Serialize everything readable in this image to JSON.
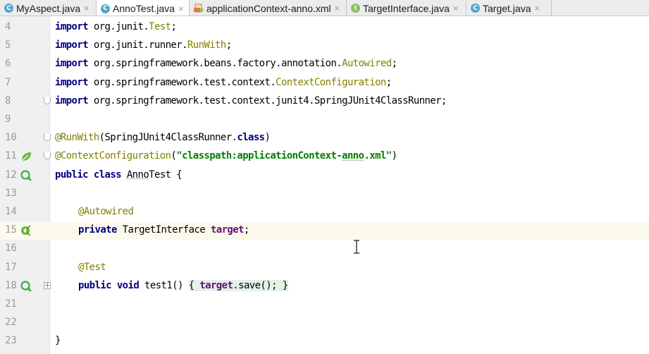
{
  "tabs": [
    {
      "label": "MyAspect.java",
      "icon": "class-icon",
      "badge": "C",
      "active": false
    },
    {
      "label": "AnnoTest.java",
      "icon": "class-icon",
      "badge": "C",
      "active": true
    },
    {
      "label": "applicationContext-anno.xml",
      "icon": "xml-file-icon",
      "badge": "",
      "active": false
    },
    {
      "label": "TargetInterface.java",
      "icon": "interface-icon",
      "badge": "I",
      "active": false
    },
    {
      "label": "Target.java",
      "icon": "class-icon",
      "badge": "C",
      "active": false
    }
  ],
  "close_glyph": "×",
  "lines": [
    {
      "num": "4",
      "indent": 0,
      "tokens": [
        {
          "t": "import",
          "c": "kw"
        },
        {
          "t": " org.junit.",
          "c": "pkg"
        },
        {
          "t": "Test",
          "c": "cls"
        },
        {
          "t": ";",
          "c": "pkg"
        }
      ]
    },
    {
      "num": "5",
      "indent": 0,
      "tokens": [
        {
          "t": "import",
          "c": "kw"
        },
        {
          "t": " org.junit.runner.",
          "c": "pkg"
        },
        {
          "t": "RunWith",
          "c": "cls"
        },
        {
          "t": ";",
          "c": "pkg"
        }
      ]
    },
    {
      "num": "6",
      "indent": 0,
      "tokens": [
        {
          "t": "import",
          "c": "kw"
        },
        {
          "t": " org.springframework.beans.factory.annotation.",
          "c": "pkg"
        },
        {
          "t": "Autowired",
          "c": "cls"
        },
        {
          "t": ";",
          "c": "pkg"
        }
      ]
    },
    {
      "num": "7",
      "indent": 0,
      "tokens": [
        {
          "t": "import",
          "c": "kw"
        },
        {
          "t": " org.springframework.test.context.",
          "c": "pkg"
        },
        {
          "t": "ContextConfiguration",
          "c": "cls"
        },
        {
          "t": ";",
          "c": "pkg"
        }
      ]
    },
    {
      "num": "8",
      "indent": 0,
      "fold": "minus",
      "tokens": [
        {
          "t": "import",
          "c": "kw"
        },
        {
          "t": " org.springframework.test.context.junit4.SpringJUnit4ClassRunner;",
          "c": "pkg"
        }
      ]
    },
    {
      "num": "9",
      "indent": 0,
      "tokens": []
    },
    {
      "num": "10",
      "indent": 0,
      "fold": "minus",
      "tokens": [
        {
          "t": "@RunWith",
          "c": "ann"
        },
        {
          "t": "(SpringJUnit4ClassRunner.",
          "c": "pkg"
        },
        {
          "t": "class",
          "c": "kw"
        },
        {
          "t": ")",
          "c": "pkg"
        }
      ]
    },
    {
      "num": "11",
      "indent": 0,
      "fold": "minus",
      "gutter": "spring-leaf-icon",
      "tokens": [
        {
          "t": "@ContextConfiguration",
          "c": "ann"
        },
        {
          "t": "(",
          "c": "pkg"
        },
        {
          "t": "\"classpath:applicationContext-",
          "c": "str"
        },
        {
          "t": "anno",
          "c": "str ul"
        },
        {
          "t": ".xml\"",
          "c": "str"
        },
        {
          "t": ")",
          "c": "pkg"
        }
      ]
    },
    {
      "num": "12",
      "indent": 0,
      "gutter": "run-test-icon",
      "tokens": [
        {
          "t": "public",
          "c": "kw"
        },
        {
          "t": " ",
          "c": "pkg"
        },
        {
          "t": "class",
          "c": "kw"
        },
        {
          "t": " ",
          "c": "pkg"
        },
        {
          "t": "Anno",
          "c": "pkg ul"
        },
        {
          "t": "Test {",
          "c": "pkg"
        }
      ]
    },
    {
      "num": "13",
      "indent": 0,
      "tokens": []
    },
    {
      "num": "14",
      "indent": 1,
      "tokens": [
        {
          "t": "@Autowired",
          "c": "ann"
        }
      ]
    },
    {
      "num": "15",
      "indent": 1,
      "current": true,
      "gutter": "autowired-bean-icon",
      "tokens": [
        {
          "t": "private",
          "c": "kw"
        },
        {
          "t": " TargetInterface ",
          "c": "pkg"
        },
        {
          "t": "target",
          "c": "fld"
        },
        {
          "t": ";",
          "c": "pkg"
        }
      ]
    },
    {
      "num": "16",
      "indent": 0,
      "tokens": []
    },
    {
      "num": "17",
      "indent": 1,
      "tokens": [
        {
          "t": "@Test",
          "c": "ann"
        }
      ]
    },
    {
      "num": "18",
      "indent": 1,
      "fold": "plus",
      "gutter": "run-test-icon",
      "tokens": [
        {
          "t": "public",
          "c": "kw"
        },
        {
          "t": " ",
          "c": "pkg"
        },
        {
          "t": "void",
          "c": "kw"
        },
        {
          "t": " test1() ",
          "c": "pkg"
        },
        {
          "t": "{ ",
          "c": "pkg brace"
        },
        {
          "t": "target",
          "c": "fld brace"
        },
        {
          "t": ".save(); }",
          "c": "pkg brace"
        }
      ]
    },
    {
      "num": "21",
      "indent": 0,
      "tokens": []
    },
    {
      "num": "22",
      "indent": 0,
      "tokens": []
    },
    {
      "num": "23",
      "indent": 0,
      "tokens": [
        {
          "t": "}",
          "c": "pkg"
        }
      ]
    }
  ]
}
